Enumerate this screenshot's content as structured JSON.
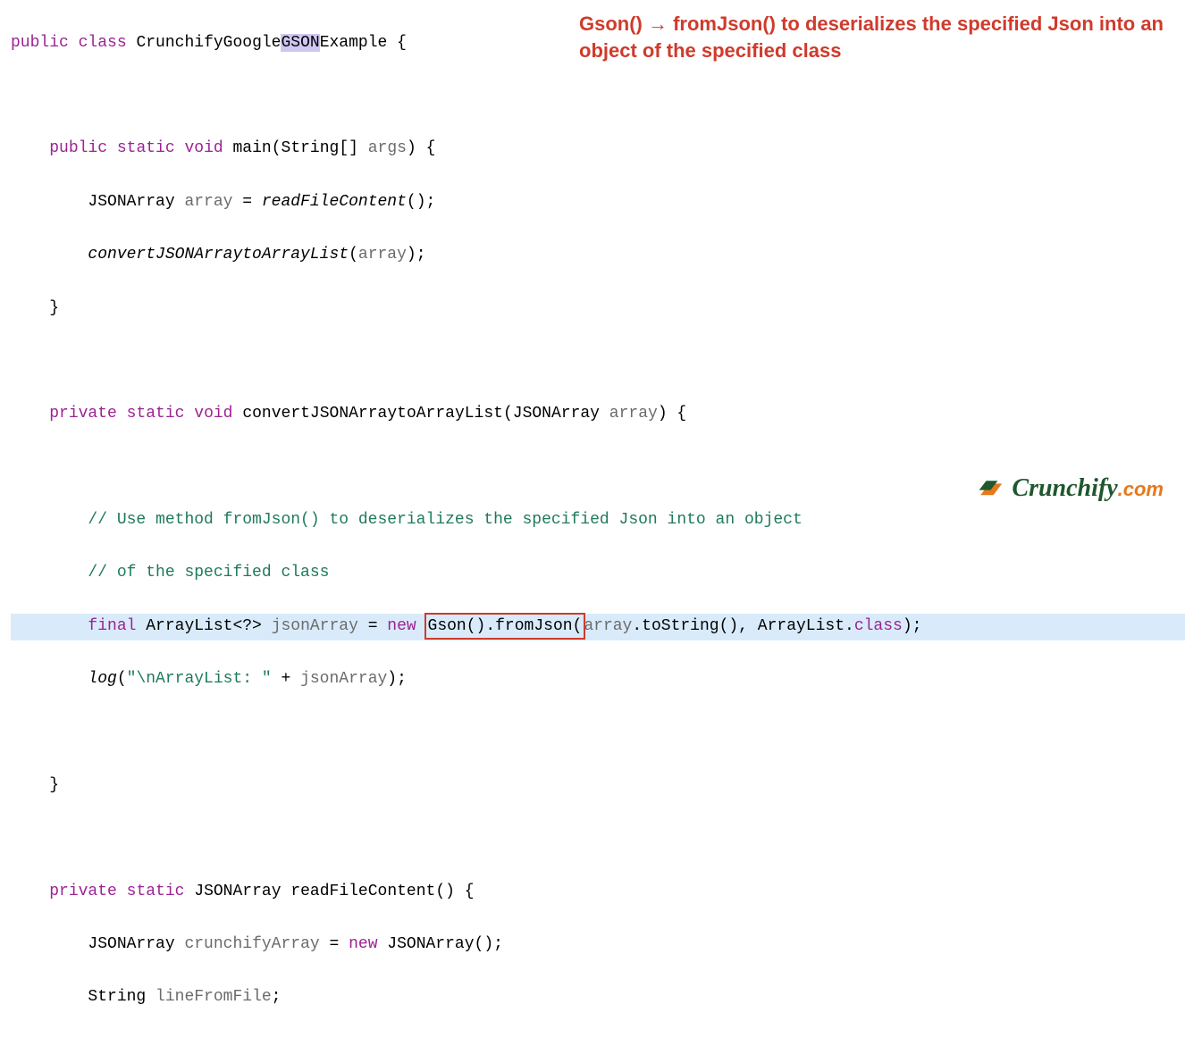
{
  "annotation": "Gson() → fromJson() to deserializes the specified Json into an object of the specified class",
  "code": {
    "l1_kw1": "public",
    "l1_kw2": "class",
    "l1_name_pre": "CrunchifyGoogle",
    "l1_name_hl": "GSON",
    "l1_name_post": "Example",
    "l1_brace": " {",
    "l3_sig_kw1": "public",
    "l3_sig_kw2": "static",
    "l3_sig_kw3": "void",
    "l3_sig_name": "main",
    "l3_sig_params": "(String[] ",
    "l3_sig_arg": "args",
    "l3_sig_close": ") {",
    "l4_type": "JSONArray",
    "l4_var": "array",
    "l4_eq": " = ",
    "l4_call": "readFileContent",
    "l4_end": "();",
    "l5_call": "convertJSONArraytoArrayList",
    "l5_open": "(",
    "l5_arg": "array",
    "l5_close": ");",
    "l6_brace": "}",
    "l8_kw1": "private",
    "l8_kw2": "static",
    "l8_kw3": "void",
    "l8_name": "convertJSONArraytoArrayList",
    "l8_open": "(JSONArray ",
    "l8_arg": "array",
    "l8_close": ") {",
    "l10_c1": "// Use method fromJson() to deserializes the specified Json into an object",
    "l11_c2": "// of the specified class",
    "l12_kw_final": "final",
    "l12_type": " ArrayList<?> ",
    "l12_var": "jsonArray",
    "l12_eq": " = ",
    "l12_kw_new": "new",
    "l12_boxed": "Gson().fromJson(",
    "l12_arg": "array",
    "l12_tostr": ".toString(), ArrayList.",
    "l12_class": "class",
    "l12_end": ");",
    "l13_log": "log",
    "l13_open": "(",
    "l13_str": "\"\\nArrayList: \"",
    "l13_plus": " + ",
    "l13_var": "jsonArray",
    "l13_close": ");",
    "l15_brace": "}",
    "l17_kw1": "private",
    "l17_kw2": "static",
    "l17_type": "JSONArray",
    "l17_name": "readFileContent",
    "l17_close": "() {",
    "l18_type": "JSONArray",
    "l18_var": "crunchifyArray",
    "l18_eq": " = ",
    "l18_kw_new": "new",
    "l18_call": " JSONArray();",
    "l19_type": "String",
    "l19_var": "lineFromFile",
    "l19_end": ";"
  },
  "logo": {
    "brand": "Crunchify",
    "suffix": ".com"
  }
}
